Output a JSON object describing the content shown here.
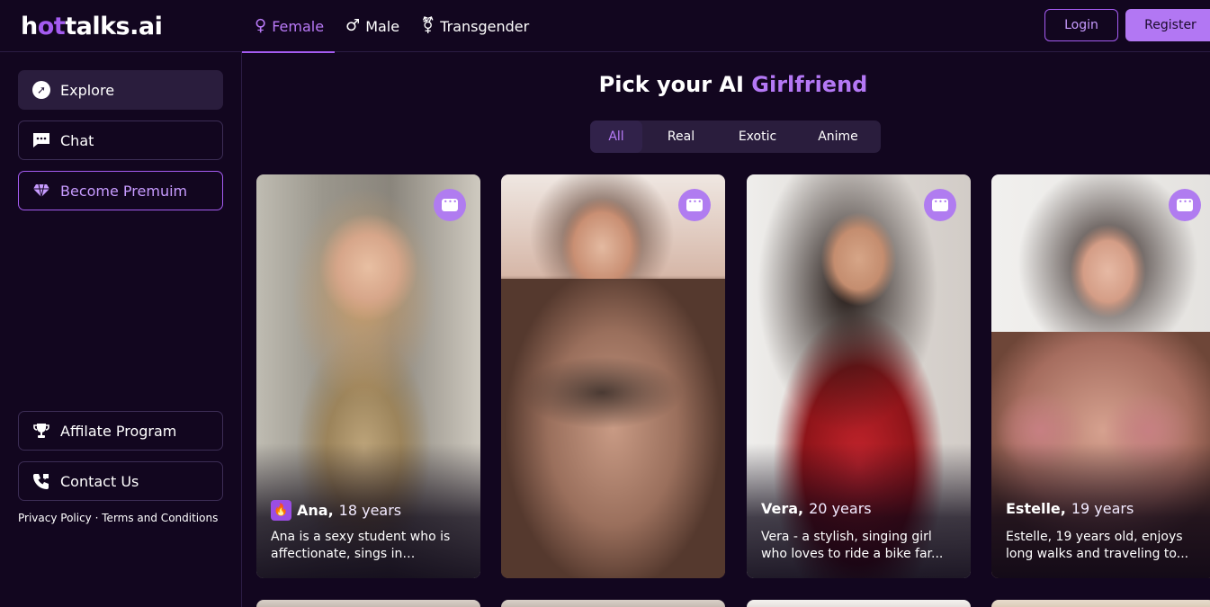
{
  "header": {
    "logo_prefix": "h",
    "logo_accent": "ot",
    "logo_suffix": "talks.ai",
    "gender_tabs": [
      {
        "label": "Female",
        "icon": "female-symbol-icon",
        "glyph": "♀",
        "active": true
      },
      {
        "label": "Male",
        "icon": "male-symbol-icon",
        "glyph": "♂",
        "active": false
      },
      {
        "label": "Transgender",
        "icon": "transgender-symbol-icon",
        "glyph": "⚧",
        "active": false
      }
    ],
    "login_label": "Login",
    "register_label": "Register"
  },
  "sidebar": {
    "items": [
      {
        "label": "Explore",
        "icon": "compass-icon"
      },
      {
        "label": "Chat",
        "icon": "chat-icon"
      },
      {
        "label": "Become Premuim",
        "icon": "diamond-icon"
      }
    ],
    "bottom_items": [
      {
        "label": "Affilate Program",
        "icon": "trophy-icon"
      },
      {
        "label": "Contact Us",
        "icon": "phone-icon"
      }
    ],
    "privacy_label": "Privacy Policy",
    "separator": "·",
    "terms_label": "Terms and Conditions"
  },
  "main": {
    "heading_prefix": "Pick your AI",
    "heading_highlight": "Girlfriend",
    "filters": [
      {
        "label": "All",
        "active": true
      },
      {
        "label": "Real",
        "active": false
      },
      {
        "label": "Exotic",
        "active": false
      },
      {
        "label": "Anime",
        "active": false
      }
    ],
    "cards": [
      {
        "name": "Ana,",
        "age": "18 years",
        "description": "Ana is a sexy student who is affectionate, sings in karaoke,...",
        "badge": "flame-icon"
      },
      {
        "name": "",
        "age": "",
        "description": "",
        "badge": ""
      },
      {
        "name": "Vera,",
        "age": "20 years",
        "description": "Vera - a stylish, singing girl who loves to ride a bike far...",
        "badge": ""
      },
      {
        "name": "Estelle,",
        "age": "19 years",
        "description": "Estelle, 19 years old, enjoys long walks and traveling to...",
        "badge": ""
      }
    ]
  },
  "colors": {
    "background": "#12061f",
    "accent": "#a45bf0",
    "accent_light": "#b478f5",
    "panel": "#2a1d3d"
  }
}
